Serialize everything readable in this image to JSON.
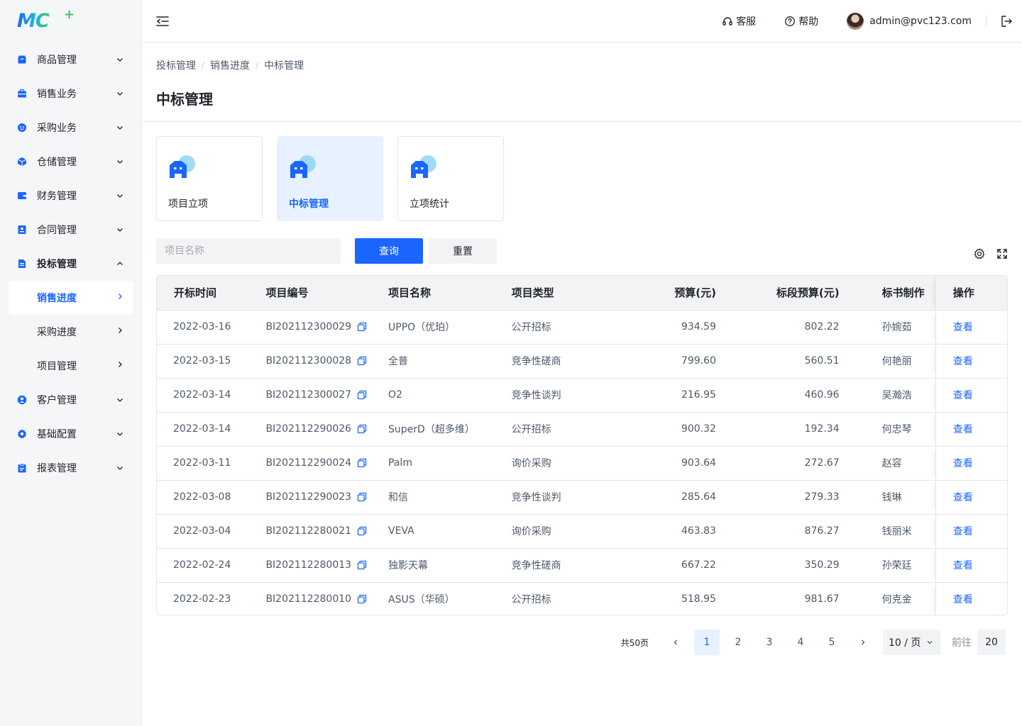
{
  "logo": {
    "text": "MC",
    "plus": "+"
  },
  "sidebar": {
    "items": [
      {
        "label": "商品管理",
        "icon": "package-icon"
      },
      {
        "label": "销售业务",
        "icon": "briefcase-icon"
      },
      {
        "label": "采购业务",
        "icon": "cart-icon"
      },
      {
        "label": "仓储管理",
        "icon": "cube-icon"
      },
      {
        "label": "财务管理",
        "icon": "wallet-icon"
      },
      {
        "label": "合同管理",
        "icon": "contract-icon"
      },
      {
        "label": "投标管理",
        "icon": "document-icon",
        "open": true,
        "children": [
          {
            "label": "销售进度",
            "active": true
          },
          {
            "label": "采购进度"
          },
          {
            "label": "项目管理"
          }
        ]
      },
      {
        "label": "客户管理",
        "icon": "user-icon"
      },
      {
        "label": "基础配置",
        "icon": "gear-icon"
      },
      {
        "label": "报表管理",
        "icon": "clipboard-icon"
      }
    ]
  },
  "header": {
    "service": "客服",
    "help": "帮助",
    "email": "admin@pvc123.com"
  },
  "breadcrumb": [
    "投标管理",
    "销售进度",
    "中标管理"
  ],
  "page_title": "中标管理",
  "cards": [
    {
      "label": "项目立项",
      "active": false
    },
    {
      "label": "中标管理",
      "active": true
    },
    {
      "label": "立项统计",
      "active": false
    }
  ],
  "search": {
    "placeholder": "项目名称",
    "value": "",
    "query_label": "查询",
    "reset_label": "重置"
  },
  "table": {
    "columns": [
      "开标时间",
      "项目编号",
      "项目名称",
      "项目类型",
      "预算(元)",
      "标段预算(元)",
      "标书制作",
      "操作"
    ],
    "rows": [
      [
        "2022-03-16",
        "BI202112300029",
        "UPPO（优珀）",
        "公开招标",
        "934.59",
        "802.22",
        "孙婉茹",
        "查看"
      ],
      [
        "2022-03-15",
        "BI202112300028",
        "全普",
        "竞争性磋商",
        "799.60",
        "560.51",
        "何艳丽",
        "查看"
      ],
      [
        "2022-03-14",
        "BI202112300027",
        "O2",
        "竞争性谈判",
        "216.95",
        "460.96",
        "吴瀚浩",
        "查看"
      ],
      [
        "2022-03-14",
        "BI202112290026",
        "SuperD（超多维）",
        "公开招标",
        "900.32",
        "192.34",
        "何忠琴",
        "查看"
      ],
      [
        "2022-03-11",
        "BI202112290024",
        "Palm",
        "询价采购",
        "903.64",
        "272.67",
        "赵容",
        "查看"
      ],
      [
        "2022-03-08",
        "BI202112290023",
        "和信",
        "竞争性谈判",
        "285.64",
        "279.33",
        "钱琳",
        "查看"
      ],
      [
        "2022-03-04",
        "BI202112280021",
        "VEVA",
        "询价采购",
        "463.83",
        "876.27",
        "钱丽米",
        "查看"
      ],
      [
        "2022-02-24",
        "BI202112280013",
        "独影天幕",
        "竞争性磋商",
        "667.22",
        "350.29",
        "孙荣廷",
        "查看"
      ],
      [
        "2022-02-23",
        "BI202112280010",
        "ASUS（华硕）",
        "公开招标",
        "518.95",
        "981.67",
        "何克金",
        "查看"
      ]
    ]
  },
  "pagination": {
    "total": "共50页",
    "pages": [
      "1",
      "2",
      "3",
      "4",
      "5"
    ],
    "current": "1",
    "page_size": "10 / 页",
    "goto_label": "前往",
    "goto_value": "20"
  },
  "colors": {
    "primary": "#1a66ff",
    "active_bg": "#e8f1ff"
  }
}
